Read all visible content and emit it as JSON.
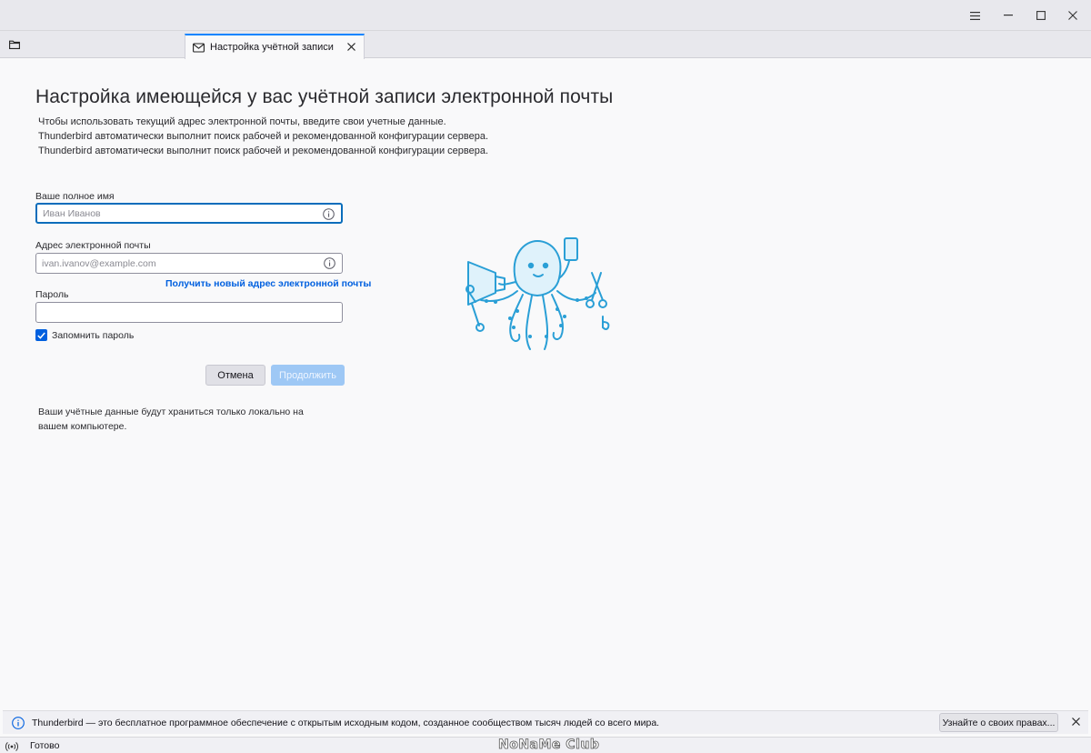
{
  "window": {
    "menu_icon": "hamburger-menu-icon",
    "minimize_icon": "minimize-icon",
    "maximize_icon": "maximize-icon",
    "close_icon": "close-icon"
  },
  "tabbar": {
    "folder_icon": "folder-icon",
    "tab": {
      "icon": "envelope-icon",
      "label": "Настройка учётной записи",
      "close_icon": "close-icon"
    }
  },
  "main": {
    "title": "Настройка имеющейся у вас учётной записи электронной почты",
    "intro": [
      "Чтобы использовать текущий адрес электронной почты, введите свои учетные данные.",
      "Thunderbird автоматически выполнит поиск рабочей и рекомендованной конфигурации сервера.",
      "Thunderbird автоматически выполнит поиск рабочей и рекомендованной конфигурации сервера."
    ],
    "form": {
      "name_label": "Ваше полное имя",
      "name_placeholder": "Иван Иванов",
      "name_value": "",
      "email_label": "Адрес электронной почты",
      "email_placeholder": "ivan.ivanov@example.com",
      "email_value": "",
      "new_address_link": "Получить новый адрес электронной почты",
      "password_label": "Пароль",
      "password_value": "",
      "remember_label": "Запомнить пароль",
      "remember_checked": true,
      "cancel_label": "Отмена",
      "continue_label": "Продолжить"
    },
    "storage_note": "Ваши учётные данные будут храниться только локально на вашем компьютере.",
    "mascot": "octopus-mascot-illustration"
  },
  "notification": {
    "icon": "info-icon",
    "text": "Thunderbird — это бесплатное программное обеспечение с открытым исходным кодом, созданное сообществом тысяч людей со всего мира.",
    "button_label": "Узнайте о своих правах...",
    "close_icon": "close-icon"
  },
  "statusbar": {
    "icon": "online-status-icon",
    "text": "Готово",
    "watermark": "NoNaMe Club"
  },
  "colors": {
    "accent": "#0060df",
    "focus_border": "#0a6dbb",
    "disabled_primary": "#9ec8f5",
    "mascot_line": "#2a9fd6",
    "mascot_fill": "#dff2fb"
  }
}
